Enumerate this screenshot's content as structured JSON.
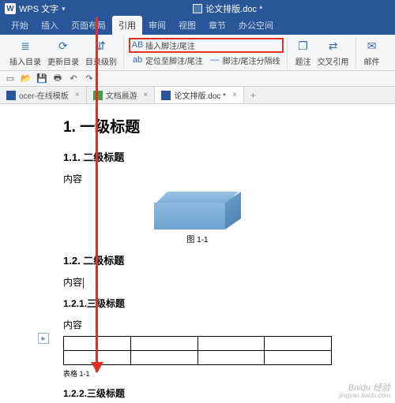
{
  "title_bar": {
    "app_name": "WPS 文字",
    "doc_icon_title": "论文排版.doc *"
  },
  "menu": {
    "items": [
      "开始",
      "插入",
      "页面布局",
      "引用",
      "审阅",
      "视图",
      "章节",
      "办公空间"
    ],
    "active_index": 3
  },
  "ribbon": {
    "insert_toc": "插入目录",
    "update_toc": "更新目录",
    "toc_level": "目录级别",
    "insert_footnote": "插入脚注/尾注",
    "goto_footnote": "定位至脚注/尾注",
    "footnote_sep": "脚注/尾注分隔线",
    "caption": "题注",
    "crossref": "交叉引用",
    "mail": "邮件"
  },
  "tabs": {
    "items": [
      {
        "label": "ocer-在线模板",
        "icon_bg": "#2a5699"
      },
      {
        "label": "文档晨游",
        "icon_bg": "#4a9a4a"
      },
      {
        "label": "论文排版.doc *",
        "icon_bg": "#2a5699"
      }
    ],
    "active_index": 2
  },
  "doc": {
    "h1_prefix": "1. ",
    "h1": "一级标题",
    "h2a": "1.1. 二级标题",
    "p_content": "内容",
    "fig_caption": "图  1-1",
    "h2b": "1.2. 二级标题",
    "h3a": "1.2.1.三级标题",
    "tbl_caption": "表格  1-1",
    "h3b": "1.2.2.三级标题"
  },
  "watermark": {
    "main": "Baidu 经验",
    "sub": "jingyan.baidu.com"
  }
}
